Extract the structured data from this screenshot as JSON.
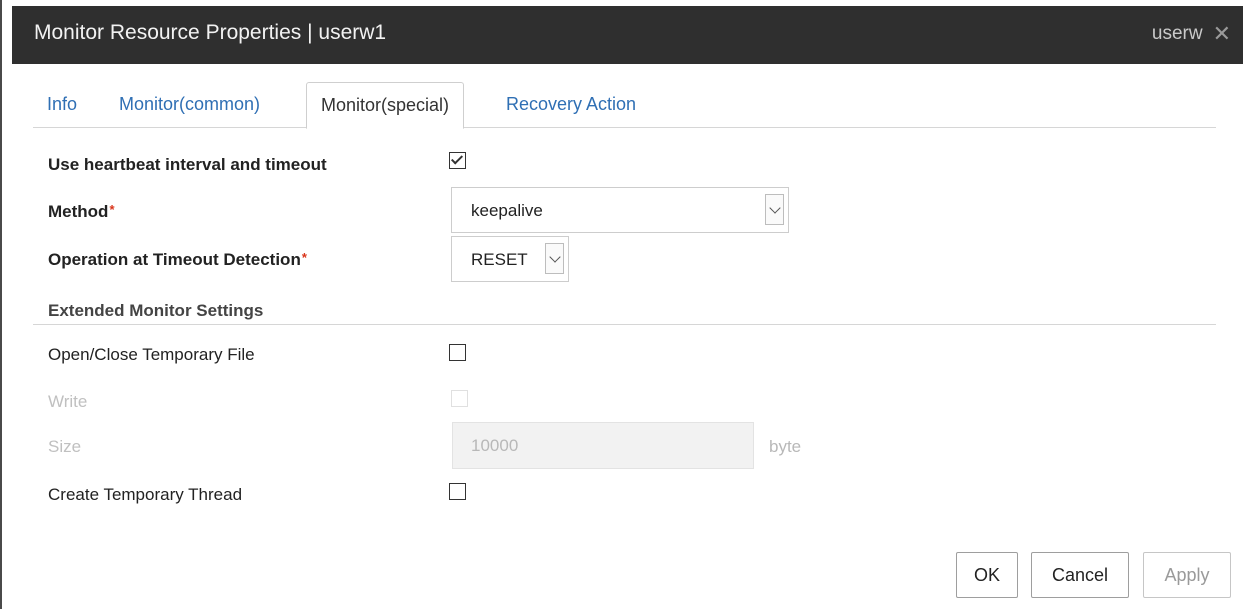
{
  "window": {
    "title": "Monitor Resource Properties | userw1",
    "right_label": "userw",
    "close_glyph": "✕"
  },
  "tabs": [
    {
      "label": "Info",
      "active": false
    },
    {
      "label": "Monitor(common)",
      "active": false
    },
    {
      "label": "Monitor(special)",
      "active": true
    },
    {
      "label": "Recovery Action",
      "active": false
    }
  ],
  "form": {
    "use_heartbeat": {
      "label": "Use heartbeat interval and timeout",
      "checked": true
    },
    "method": {
      "label": "Method",
      "required_mark": "*",
      "value": "keepalive"
    },
    "operation": {
      "label": "Operation at Timeout Detection",
      "required_mark": "*",
      "value": "RESET"
    },
    "extended_section_title": "Extended Monitor Settings",
    "open_close_temp_file": {
      "label": "Open/Close Temporary File",
      "checked": false
    },
    "write": {
      "label": "Write",
      "checked": false,
      "disabled": true
    },
    "size": {
      "label": "Size",
      "value": "10000",
      "unit": "byte",
      "disabled": true
    },
    "create_temp_thread": {
      "label": "Create Temporary Thread",
      "checked": false
    }
  },
  "buttons": {
    "ok": "OK",
    "cancel": "Cancel",
    "apply": "Apply"
  },
  "icons": {
    "close": "close-icon",
    "dropdown": "chevron-down-icon",
    "checkbox_checked": "check-icon"
  }
}
